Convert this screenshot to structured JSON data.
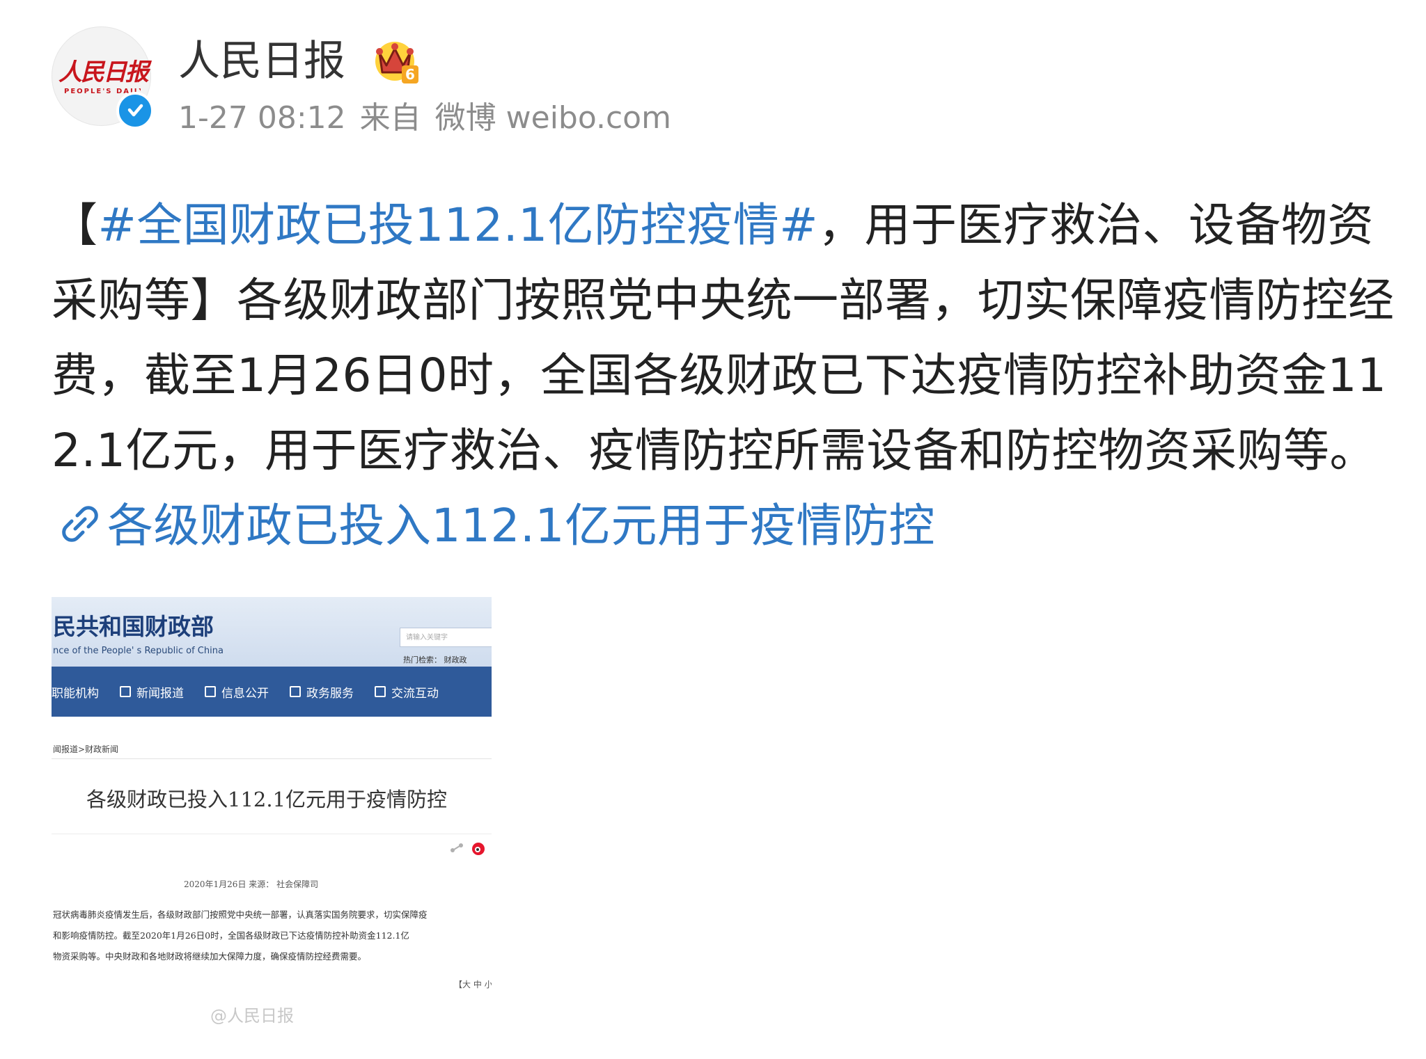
{
  "header": {
    "avatar_logo": "人民日报",
    "avatar_logo_sub": "PEOPLE'S DAILY",
    "username": "人民日报",
    "member_level": "6",
    "date": "1-27 08:12",
    "from_label": "来自",
    "source_app": "微博 weibo.com"
  },
  "post": {
    "bracket_open": "【",
    "topic": "#全国财政已投112.1亿防控疫情#",
    "headline_rest": "，用于医疗救治、设备物资采购等】",
    "body": "各级财政部门按照党中央统一部署，切实保障疫情防控经费，截至1月26日0时，全国各级财政已下达疫情防控补助资金112.1亿元，用于医疗救治、疫情防控所需设备和防控物资采购等。",
    "link_text": "各级财政已投入112.1亿元用于疫情防控"
  },
  "attachment": {
    "site_title": "民共和国财政部",
    "site_subtitle": "nce of the People' s Republic of China",
    "search_placeholder": "请输入关键字",
    "hot_search": "热门检索：  财政政",
    "nav": [
      "职能机构",
      "新闻报道",
      "信息公开",
      "政务服务",
      "交流互动"
    ],
    "breadcrumb": "闻报道>财政新闻",
    "article_title": "各级财政已投入112.1亿元用于疫情防控",
    "date_source": "2020年1月26日  来源：  社会保障司",
    "paragraph_lines": [
      "冠状病毒肺炎疫情发生后，各级财政部门按照党中央统一部署，认真落实国务院要求，切实保障疫",
      "和影响疫情防控。截至2020年1月26日0时，全国各级财政已下达疫情防控补助资金112.1亿",
      "物资采购等。中央财政和各地财政将继续加大保障力度，确保疫情防控经费需要。"
    ],
    "font_size_control": "【大 中 小",
    "watermark": "@人民日报"
  },
  "colors": {
    "topic_link": "#2f78c4",
    "verified_badge": "#1a94e6",
    "crown": "#f5a623",
    "logo_red": "#c8161d",
    "nav_bar": "#2f5a9a"
  },
  "icons": {
    "verified": "verified-check-icon",
    "crown": "crown-level-icon",
    "link": "link-chain-icon"
  }
}
